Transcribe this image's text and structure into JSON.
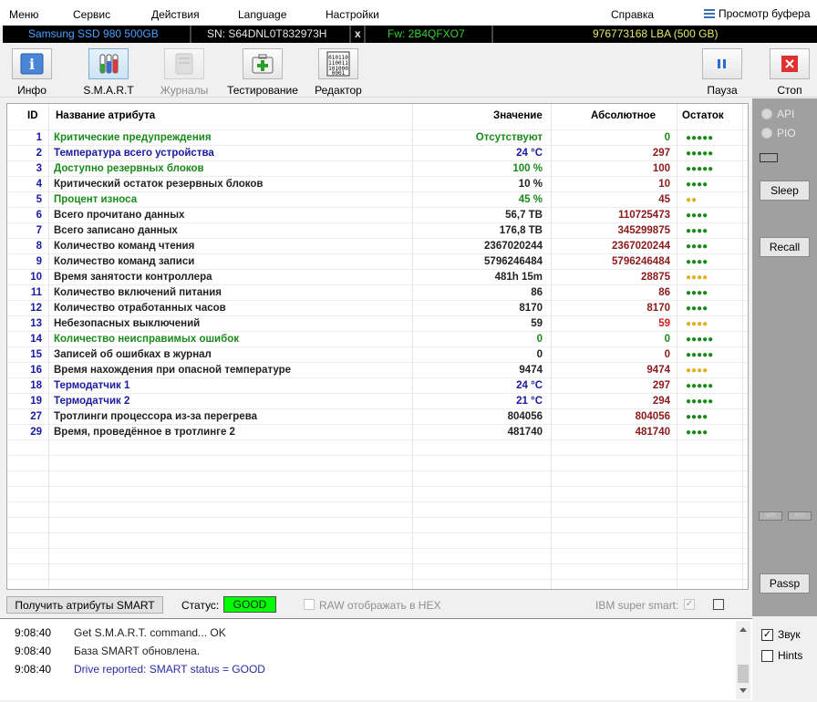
{
  "menu": {
    "items": [
      "Меню",
      "Сервис",
      "Действия",
      "Language",
      "Настройки",
      "Справка"
    ],
    "clipboard_label": "Просмотр буфера"
  },
  "device": {
    "model": "Samsung SSD 980 500GB",
    "serial": "SN: S64DNL0T832973H",
    "close_glyph": "x",
    "firmware": "Fw: 2B4QFXO7",
    "capacity": "976773168 LBA (500 GB)"
  },
  "toolbar": {
    "info": "Инфо",
    "smart": "S.M.A.R.T",
    "logs": "Журналы",
    "testing": "Тестирование",
    "editor": "Редактор",
    "pause": "Пауза",
    "stop": "Стоп"
  },
  "table": {
    "headers": [
      "ID",
      "Название атрибута",
      "Значение",
      "Абсолютное",
      "Остаток"
    ],
    "rows": [
      {
        "id": "1",
        "name": "Критические предупреждения",
        "value": "Отсутствуют",
        "abs": "0",
        "rem": "●●●●●",
        "nc": "#1a8a1a",
        "vc": "#1a8a1a",
        "ac": "#1a8a1a",
        "dc": "#1a8a1a"
      },
      {
        "id": "2",
        "name": "Температура всего устройства",
        "value": "24 °C",
        "abs": "297",
        "rem": "●●●●●",
        "nc": "#1a1aa0",
        "vc": "#1a1aa0",
        "ac": "#8b1a1a",
        "dc": "#1a8a1a"
      },
      {
        "id": "3",
        "name": "Доступно резервных блоков",
        "value": "100 %",
        "abs": "100",
        "rem": "●●●●●",
        "nc": "#1a8a1a",
        "vc": "#1a8a1a",
        "ac": "#8b1a1a",
        "dc": "#1a8a1a"
      },
      {
        "id": "4",
        "name": "Критический остаток резервных блоков",
        "value": "10 %",
        "abs": "10",
        "rem": "●●●●",
        "nc": "#222",
        "vc": "#222",
        "ac": "#8b1a1a",
        "dc": "#1a8a1a"
      },
      {
        "id": "5",
        "name": "Процент износа",
        "value": "45 %",
        "abs": "45",
        "rem": "●●",
        "nc": "#1a8a1a",
        "vc": "#1a8a1a",
        "ac": "#8b1a1a",
        "dc": "#e0b020"
      },
      {
        "id": "6",
        "name": "Всего прочитано данных",
        "value": "56,7 TB",
        "abs": "110725473",
        "rem": "●●●●",
        "nc": "#222",
        "vc": "#222",
        "ac": "#8b1a1a",
        "dc": "#1a8a1a"
      },
      {
        "id": "7",
        "name": "Всего записано данных",
        "value": "176,8 TB",
        "abs": "345299875",
        "rem": "●●●●",
        "nc": "#222",
        "vc": "#222",
        "ac": "#8b1a1a",
        "dc": "#1a8a1a"
      },
      {
        "id": "8",
        "name": "Количество команд чтения",
        "value": "2367020244",
        "abs": "2367020244",
        "rem": "●●●●",
        "nc": "#222",
        "vc": "#222",
        "ac": "#8b1a1a",
        "dc": "#1a8a1a"
      },
      {
        "id": "9",
        "name": "Количество команд записи",
        "value": "5796246484",
        "abs": "5796246484",
        "rem": "●●●●",
        "nc": "#222",
        "vc": "#222",
        "ac": "#8b1a1a",
        "dc": "#1a8a1a"
      },
      {
        "id": "10",
        "name": "Время занятости контроллера",
        "value": "481h 15m",
        "abs": "28875",
        "rem": "●●●●",
        "nc": "#222",
        "vc": "#222",
        "ac": "#8b1a1a",
        "dc": "#e0b020"
      },
      {
        "id": "11",
        "name": "Количество включений питания",
        "value": "86",
        "abs": "86",
        "rem": "●●●●",
        "nc": "#222",
        "vc": "#222",
        "ac": "#8b1a1a",
        "dc": "#1a8a1a"
      },
      {
        "id": "12",
        "name": "Количество отработанных часов",
        "value": "8170",
        "abs": "8170",
        "rem": "●●●●",
        "nc": "#222",
        "vc": "#222",
        "ac": "#8b1a1a",
        "dc": "#1a8a1a"
      },
      {
        "id": "13",
        "name": "Небезопасных выключений",
        "value": "59",
        "abs": "59",
        "rem": "●●●●",
        "nc": "#222",
        "vc": "#222",
        "ac": "#cc2020",
        "dc": "#e0b020"
      },
      {
        "id": "14",
        "name": "Количество неисправимых ошибок",
        "value": "0",
        "abs": "0",
        "rem": "●●●●●",
        "nc": "#1a8a1a",
        "vc": "#1a8a1a",
        "ac": "#1a8a1a",
        "dc": "#1a8a1a"
      },
      {
        "id": "15",
        "name": "Записей об ошибках в журнал",
        "value": "0",
        "abs": "0",
        "rem": "●●●●●",
        "nc": "#222",
        "vc": "#222",
        "ac": "#8b1a1a",
        "dc": "#1a8a1a"
      },
      {
        "id": "16",
        "name": "Время нахождения при опасной температуре",
        "value": "9474",
        "abs": "9474",
        "rem": "●●●●",
        "nc": "#222",
        "vc": "#222",
        "ac": "#8b1a1a",
        "dc": "#e0b020"
      },
      {
        "id": "18",
        "name": "Термодатчик 1",
        "value": "24 °C",
        "abs": "297",
        "rem": "●●●●●",
        "nc": "#1a1aa0",
        "vc": "#1a1aa0",
        "ac": "#8b1a1a",
        "dc": "#1a8a1a"
      },
      {
        "id": "19",
        "name": "Термодатчик 2",
        "value": "21 °C",
        "abs": "294",
        "rem": "●●●●●",
        "nc": "#1a1aa0",
        "vc": "#1a1aa0",
        "ac": "#8b1a1a",
        "dc": "#1a8a1a"
      },
      {
        "id": "27",
        "name": "Тротлинги процессора из-за перегрева",
        "value": "804056",
        "abs": "804056",
        "rem": "●●●●",
        "nc": "#222",
        "vc": "#222",
        "ac": "#8b1a1a",
        "dc": "#1a8a1a"
      },
      {
        "id": "29",
        "name": "Время, проведённое в тротлинге 2",
        "value": "481740",
        "abs": "481740",
        "rem": "●●●●",
        "nc": "#222",
        "vc": "#222",
        "ac": "#8b1a1a",
        "dc": "#1a8a1a"
      }
    ]
  },
  "right_panel": {
    "api": "API",
    "pio": "PIO",
    "sleep": "Sleep",
    "recall": "Recall",
    "small1": "WR",
    "small2": "RD",
    "passp": "Passp"
  },
  "bottom": {
    "get_button": "Получить атрибуты SMART",
    "status_label": "Статус:",
    "status_value": "GOOD",
    "raw_hex": "RAW отображать в HEX",
    "ibm": "IBM super smart:"
  },
  "log": [
    {
      "time": "9:08:40",
      "msg": "Get S.M.A.R.T. command... OK",
      "color": "#222"
    },
    {
      "time": "9:08:40",
      "msg": "База SMART обновлена.",
      "color": "#222"
    },
    {
      "time": "9:08:40",
      "msg": "Drive reported: SMART status = GOOD",
      "color": "#2a2aa8"
    }
  ],
  "side_checks": {
    "sound": "Звук",
    "hints": "Hints"
  },
  "colors": {
    "status_good": "#00ff00",
    "device_model": "#4aa0ff",
    "device_fw": "#38d038",
    "device_capacity": "#e8e870"
  }
}
